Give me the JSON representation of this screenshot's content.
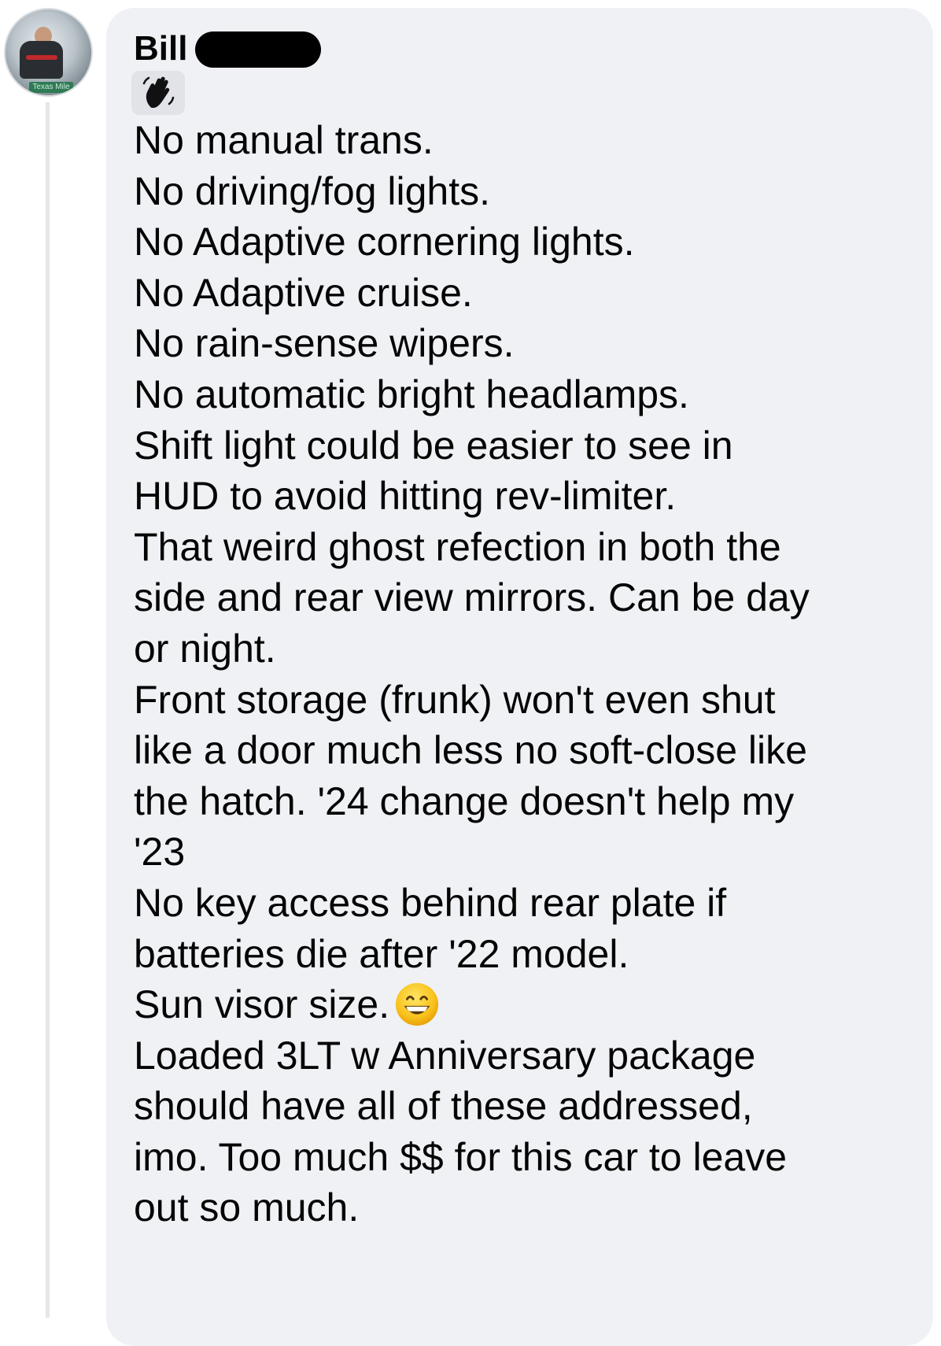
{
  "comment": {
    "author": "Bill",
    "badge_icon": "waving-hand-icon",
    "lines": [
      "No manual trans.",
      "No driving/fog lights.",
      "No Adaptive cornering lights.",
      "No Adaptive cruise.",
      "No rain-sense wipers.",
      "No automatic bright headlamps.",
      "Shift light could be easier to see in",
      "HUD to avoid hitting rev-limiter.",
      "That weird ghost refection in both the",
      "side and rear view mirrors. Can be day",
      "or night.",
      "Front storage (frunk) won't even shut",
      "like a door much less no soft-close like",
      "the hatch. '24 change doesn't help my",
      "'23",
      "No key access behind rear plate if",
      "batteries die after '22 model.",
      "Sun visor size.",
      "Loaded 3LT w Anniversary package",
      "should have all of these addressed,",
      "imo. Too much $$ for this car to leave",
      "out so much."
    ],
    "emoji": "grinning-face-icon"
  },
  "avatar": {
    "tag_text": "Texas Mile"
  },
  "colors": {
    "bubble": "#f0f1f5",
    "text": "#050505",
    "thread_line": "#e4e6ea"
  }
}
